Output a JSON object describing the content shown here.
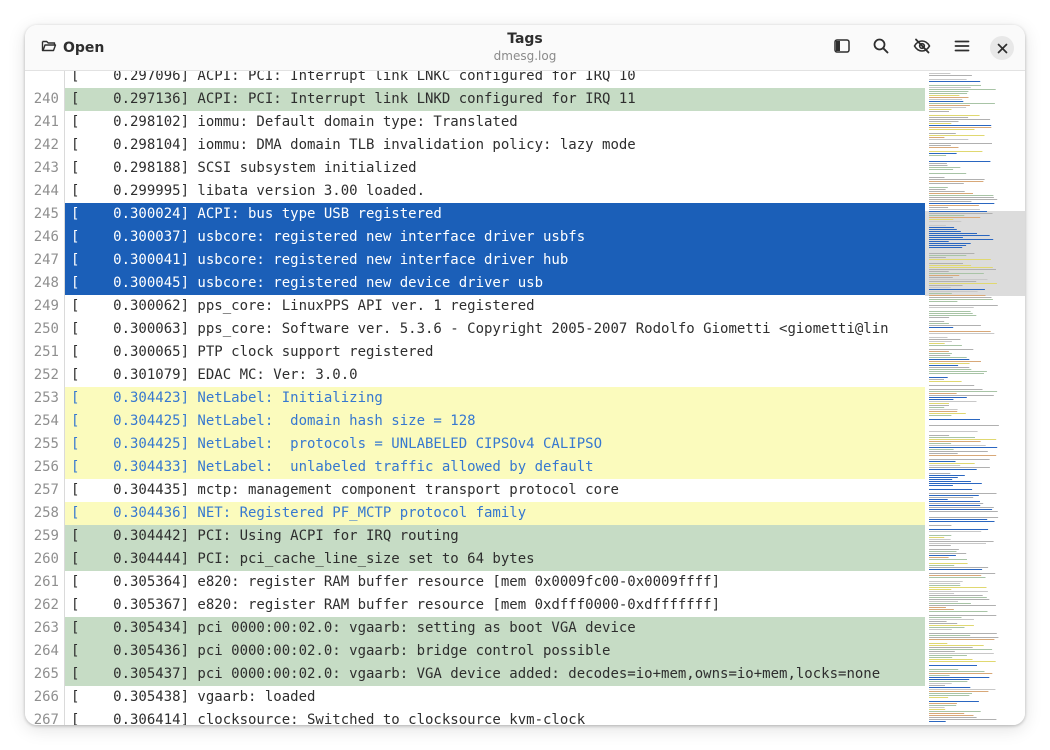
{
  "header": {
    "open_label": "Open",
    "title": "Tags",
    "subtitle": "dmesg.log"
  },
  "icons": {
    "open": "folder-open-icon",
    "sidebar": "sidebar-toggle-icon",
    "search": "search-icon",
    "hide": "eye-hidden-icon",
    "menu": "hamburger-menu-icon",
    "close": "close-icon"
  },
  "colors": {
    "tag_green": "#c6dcc5",
    "tag_blue": "#1b5fb8",
    "tag_yellow": "#fbfbbd",
    "tag_yellow_text": "#3678d0"
  },
  "log": {
    "partial_top": "[    0.297096] ACPI: PCI: Interrupt link LNKC configured for IRQ 10",
    "lines": [
      {
        "num": "240",
        "text": "[    0.297136] ACPI: PCI: Interrupt link LNKD configured for IRQ 11",
        "tag": "green"
      },
      {
        "num": "241",
        "text": "[    0.298102] iommu: Default domain type: Translated",
        "tag": ""
      },
      {
        "num": "242",
        "text": "[    0.298104] iommu: DMA domain TLB invalidation policy: lazy mode",
        "tag": ""
      },
      {
        "num": "243",
        "text": "[    0.298188] SCSI subsystem initialized",
        "tag": ""
      },
      {
        "num": "244",
        "text": "[    0.299995] libata version 3.00 loaded.",
        "tag": ""
      },
      {
        "num": "245",
        "text": "[    0.300024] ACPI: bus type USB registered",
        "tag": "blue"
      },
      {
        "num": "246",
        "text": "[    0.300037] usbcore: registered new interface driver usbfs",
        "tag": "blue"
      },
      {
        "num": "247",
        "text": "[    0.300041] usbcore: registered new interface driver hub",
        "tag": "blue"
      },
      {
        "num": "248",
        "text": "[    0.300045] usbcore: registered new device driver usb",
        "tag": "blue"
      },
      {
        "num": "249",
        "text": "[    0.300062] pps_core: LinuxPPS API ver. 1 registered",
        "tag": ""
      },
      {
        "num": "250",
        "text": "[    0.300063] pps_core: Software ver. 5.3.6 - Copyright 2005-2007 Rodolfo Giometti <giometti@lin",
        "tag": ""
      },
      {
        "num": "251",
        "text": "[    0.300065] PTP clock support registered",
        "tag": ""
      },
      {
        "num": "252",
        "text": "[    0.301079] EDAC MC: Ver: 3.0.0",
        "tag": ""
      },
      {
        "num": "253",
        "text": "[    0.304423] NetLabel: Initializing",
        "tag": "yellow"
      },
      {
        "num": "254",
        "text": "[    0.304425] NetLabel:  domain hash size = 128",
        "tag": "yellow"
      },
      {
        "num": "255",
        "text": "[    0.304425] NetLabel:  protocols = UNLABELED CIPSOv4 CALIPSO",
        "tag": "yellow"
      },
      {
        "num": "256",
        "text": "[    0.304433] NetLabel:  unlabeled traffic allowed by default",
        "tag": "yellow"
      },
      {
        "num": "257",
        "text": "[    0.304435] mctp: management component transport protocol core",
        "tag": ""
      },
      {
        "num": "258",
        "text": "[    0.304436] NET: Registered PF_MCTP protocol family",
        "tag": "yellow"
      },
      {
        "num": "259",
        "text": "[    0.304442] PCI: Using ACPI for IRQ routing",
        "tag": "green"
      },
      {
        "num": "260",
        "text": "[    0.304444] PCI: pci_cache_line_size set to 64 bytes",
        "tag": "green"
      },
      {
        "num": "261",
        "text": "[    0.305364] e820: register RAM buffer resource [mem 0x0009fc00-0x0009ffff]",
        "tag": ""
      },
      {
        "num": "262",
        "text": "[    0.305367] e820: register RAM buffer resource [mem 0xdfff0000-0xdfffffff]",
        "tag": ""
      },
      {
        "num": "263",
        "text": "[    0.305434] pci 0000:00:02.0: vgaarb: setting as boot VGA device",
        "tag": "green"
      },
      {
        "num": "264",
        "text": "[    0.305436] pci 0000:00:02.0: vgaarb: bridge control possible",
        "tag": "green"
      },
      {
        "num": "265",
        "text": "[    0.305437] pci 0000:00:02.0: vgaarb: VGA device added: decodes=io+mem,owns=io+mem,locks=none",
        "tag": "green"
      },
      {
        "num": "266",
        "text": "[    0.305438] vgaarb: loaded",
        "tag": ""
      },
      {
        "num": "267",
        "text": "[    0.306414] clocksource: Switched to clocksource kvm-clock",
        "tag": ""
      }
    ]
  }
}
